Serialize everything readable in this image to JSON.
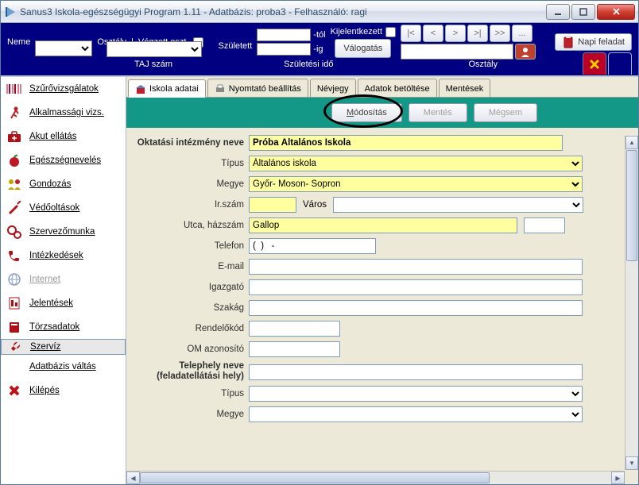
{
  "window": {
    "title": "Sanus3 Iskola-egészségügyi Program 1.11 - Adatbázis: proba3 - Felhasználó: ragi"
  },
  "toolbar": {
    "neme": "Neme",
    "osztaly": "Osztály",
    "vegzett": "Végzett oszt.",
    "szuletett": "Született",
    "tol": "-tól",
    "ig": "-ig",
    "kijelentkezett": "Kijelentkezett",
    "valogatas": "Válogatás",
    "napi": "Napi feladat",
    "taj": "TAJ szám",
    "szulido": "Születési idő",
    "osztaly2": "Osztály"
  },
  "sidebar": {
    "items": [
      {
        "label": "Szűrővizsgálatok"
      },
      {
        "label": "Alkalmassági vizs."
      },
      {
        "label": "Akut ellátás"
      },
      {
        "label": "Egészségnevelés"
      },
      {
        "label": "Gondozás"
      },
      {
        "label": "Védőoltások"
      },
      {
        "label": "Szervezőmunka"
      },
      {
        "label": "Intézkedések"
      },
      {
        "label": "Internet"
      },
      {
        "label": "Jelentések"
      },
      {
        "label": "Törzsadatok"
      },
      {
        "label": "Szervíz"
      },
      {
        "label": "Adatbázis váltás"
      },
      {
        "label": "Kilépés"
      }
    ]
  },
  "tabs": {
    "items": [
      {
        "label": "Iskola adatai"
      },
      {
        "label": "Nyomtató beállítás"
      },
      {
        "label": "Névjegy"
      },
      {
        "label": "Adatok betöltése"
      },
      {
        "label": "Mentések"
      }
    ]
  },
  "actions": {
    "modositas": "Módosítás",
    "mentes": "Mentés",
    "megsem": "Mégsem"
  },
  "form": {
    "labels": {
      "okt": "Oktatási intézmény neve",
      "tipus": "Típus",
      "megye": "Megye",
      "irszam": "Ir.szám",
      "varos": "Város",
      "utca": "Utca, házszám",
      "telefon": "Telefon",
      "email": "E-mail",
      "igazgato": "Igazgató",
      "szakag": "Szakág",
      "rendkod": "Rendelőkód",
      "omaz": "OM azonosító",
      "telephely1": "Telephely neve",
      "telephely2": "(feladatellátási hely)",
      "tipus2": "Típus",
      "megye2": "Megye"
    },
    "values": {
      "okt": "Próba Általános Iskola",
      "tipus": "Általános iskola",
      "megye": "Győr- Moson- Sopron",
      "irszam": "",
      "varos": "",
      "utca": "Gallop",
      "utca2": "",
      "telefon": "(  )   -",
      "email": "",
      "igazgato": "",
      "szakag": "",
      "rendkod": "",
      "omaz": "",
      "telephely": "",
      "tipus2": "",
      "megye2": ""
    }
  }
}
